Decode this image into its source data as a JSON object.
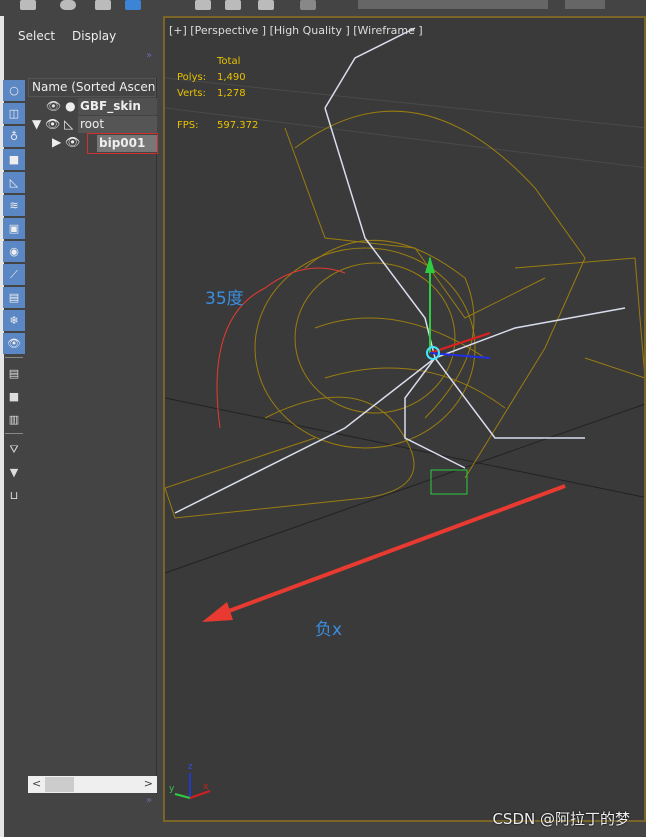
{
  "menu": {
    "select": "Select",
    "display": "Display"
  },
  "explorer": {
    "column_header": "Name (Sorted Ascending)",
    "items": [
      {
        "name": "GBF_skin",
        "level": 0,
        "type": "mesh"
      },
      {
        "name": "root",
        "level": 0,
        "type": "bone",
        "expanded": true
      },
      {
        "name": "bip001",
        "level": 1,
        "type": "biped",
        "selected": true
      }
    ]
  },
  "viewport": {
    "label": "[+] [Perspective ] [High Quality ] [Wireframe ]",
    "stats": {
      "total_label": "Total",
      "polys_label": "Polys:",
      "polys": "1,490",
      "verts_label": "Verts:",
      "verts": "1,278",
      "fps_label": "FPS:",
      "fps": "597.372"
    },
    "annotations": {
      "angle": "35度",
      "direction": "负x"
    },
    "axis": {
      "z": "z",
      "y": "y",
      "x": "x"
    }
  },
  "colors": {
    "accent": "#5b88c4",
    "wire": "#9a7d10",
    "viewport_border": "#7a6526",
    "arrow": "#e83a30",
    "annotation": "#3a8ee0",
    "stats": "#e8c200"
  },
  "watermark": "CSDN @阿拉丁的梦"
}
